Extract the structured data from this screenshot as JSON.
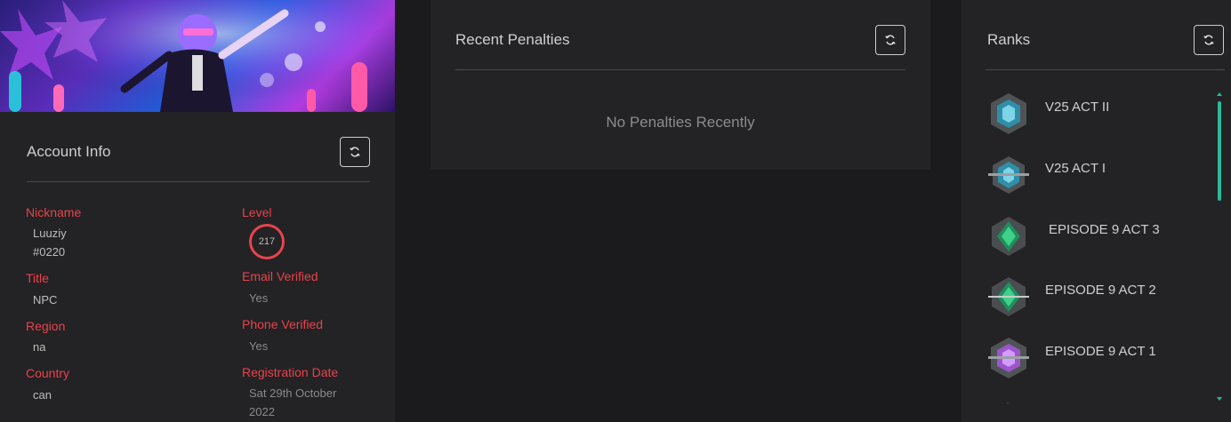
{
  "colors": {
    "accent_red": "#e8434c",
    "scroll_teal": "#2bb89a"
  },
  "account_info": {
    "title": "Account Info",
    "refresh_icon": "refresh-icon",
    "fields": {
      "nickname_label": "Nickname",
      "nickname_value_line1": "Luuziy",
      "nickname_value_line2": "#0220",
      "level_label": "Level",
      "level_value": "217",
      "title_label": "Title",
      "title_value": "NPC",
      "email_label": "Email Verified",
      "email_value": "Yes",
      "region_label": "Region",
      "region_value": "na",
      "phone_label": "Phone Verified",
      "phone_value": "Yes",
      "country_label": "Country",
      "country_value": "can",
      "reg_label": "Registration Date",
      "reg_value_line1": "Sat 29th October",
      "reg_value_line2": "2022"
    }
  },
  "penalties": {
    "title": "Recent Penalties",
    "refresh_icon": "refresh-icon",
    "empty_text": "No Penalties Recently"
  },
  "ranks": {
    "title": "Ranks",
    "refresh_icon": "refresh-icon",
    "items": [
      {
        "label": "V25 ACT II",
        "icon": "rank-platinum-icon"
      },
      {
        "label": "V25 ACT I",
        "icon": "rank-platinum-icon"
      },
      {
        "label": "EPISODE 9 ACT 3",
        "icon": "rank-ascendant-icon"
      },
      {
        "label": "EPISODE 9 ACT 2",
        "icon": "rank-ascendant-icon"
      },
      {
        "label": "EPISODE 9 ACT 1",
        "icon": "rank-diamond-icon"
      }
    ]
  }
}
